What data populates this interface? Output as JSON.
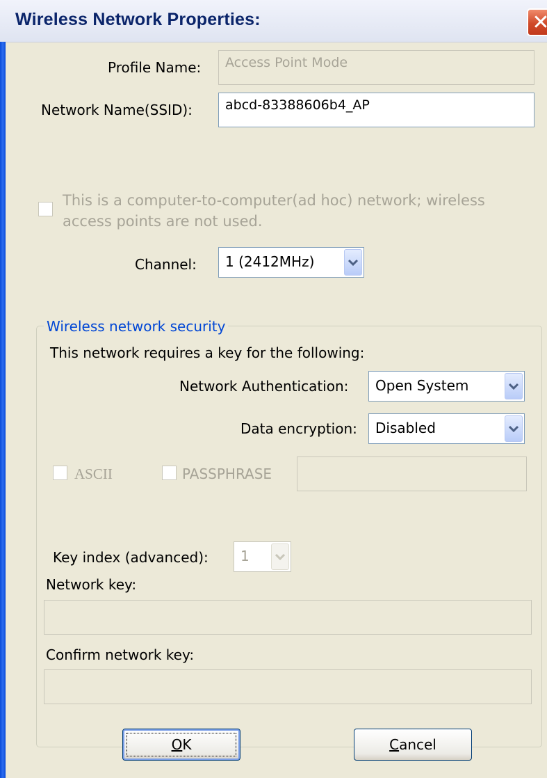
{
  "window": {
    "title": "Wireless Network Properties:",
    "close_glyph": "✕"
  },
  "profile": {
    "label": "Profile Name:",
    "value": "Access Point Mode"
  },
  "ssid": {
    "label": "Network Name(SSID):",
    "value": "abcd-83388606b4_AP"
  },
  "adhoc": {
    "line1": "This is a computer-to-computer(ad hoc) network; wireless",
    "line2": "access points are not used.",
    "checked": false
  },
  "channel": {
    "label": "Channel:",
    "value": "1  (2412MHz)"
  },
  "security": {
    "group_title": "Wireless network security",
    "description": "This network requires a key for the following:",
    "auth_label": "Network Authentication:",
    "auth_value": "Open System",
    "enc_label": "Data encryption:",
    "enc_value": "Disabled",
    "ascii_label": "ASCII",
    "passphrase_label": "PASSPHRASE",
    "passphrase_value": "",
    "key_index_label": "Key index (advanced):",
    "key_index_value": "1",
    "network_key_label": "Network key:",
    "network_key_value": "",
    "confirm_key_label": "Confirm network key:",
    "confirm_key_value": ""
  },
  "buttons": {
    "ok_prefix": "",
    "ok_mnemonic": "O",
    "ok_rest": "K",
    "cancel_prefix": "",
    "cancel_mnemonic": "C",
    "cancel_rest": "ancel"
  },
  "colors": {
    "accent_blue": "#0046d5",
    "title_text": "#0a246a",
    "dialog_bg": "#ece9d8",
    "disabled_text": "#a7a497"
  }
}
